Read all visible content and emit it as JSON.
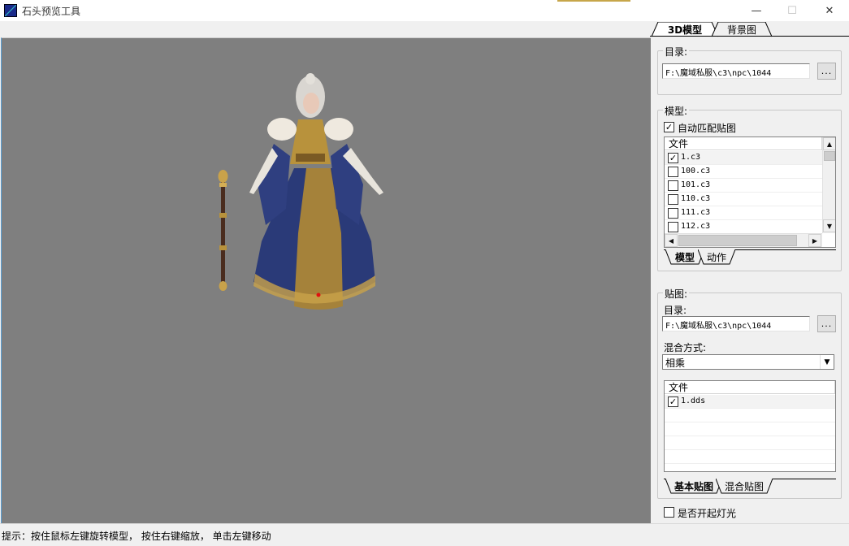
{
  "window": {
    "title": "石头预览工具",
    "controls": {
      "minimize": "—",
      "maximize": "☐",
      "close": "✕"
    }
  },
  "right_tabs": [
    "3D模型",
    "背景图"
  ],
  "dir_group": {
    "label": "目录:",
    "path": "F:\\魔域私服\\c3\\npc\\1044",
    "browse": "..."
  },
  "model_group": {
    "label": "模型:",
    "auto_match": {
      "label": "自动匹配贴图",
      "checked": true,
      "mark": "✓"
    },
    "list_header": "文件",
    "files": [
      {
        "name": "1.c3",
        "checked": true,
        "mark": "✓"
      },
      {
        "name": "100.c3",
        "checked": false,
        "mark": ""
      },
      {
        "name": "101.c3",
        "checked": false,
        "mark": ""
      },
      {
        "name": "110.c3",
        "checked": false,
        "mark": ""
      },
      {
        "name": "111.c3",
        "checked": false,
        "mark": ""
      },
      {
        "name": "112.c3",
        "checked": false,
        "mark": ""
      }
    ],
    "tabs": [
      "模型",
      "动作"
    ]
  },
  "texture_group": {
    "label": "贴图:",
    "dir_label": "目录:",
    "path": "F:\\魔域私服\\c3\\npc\\1044",
    "browse": "...",
    "blend_label": "混合方式:",
    "blend_value": "相乘",
    "list_header": "文件",
    "files": [
      {
        "name": "1.dds",
        "checked": true,
        "mark": "✓"
      }
    ],
    "tabs": [
      "基本贴图",
      "混合贴图"
    ]
  },
  "light": {
    "label": "是否开起灯光",
    "checked": false,
    "mark": ""
  },
  "status": "提示：按住鼠标左键旋转模型， 按住右键缩放， 单击左键移动",
  "colors": {
    "viewport": "#7f7f7f",
    "robe": "#2a3a78",
    "gold": "#b08a3c"
  }
}
